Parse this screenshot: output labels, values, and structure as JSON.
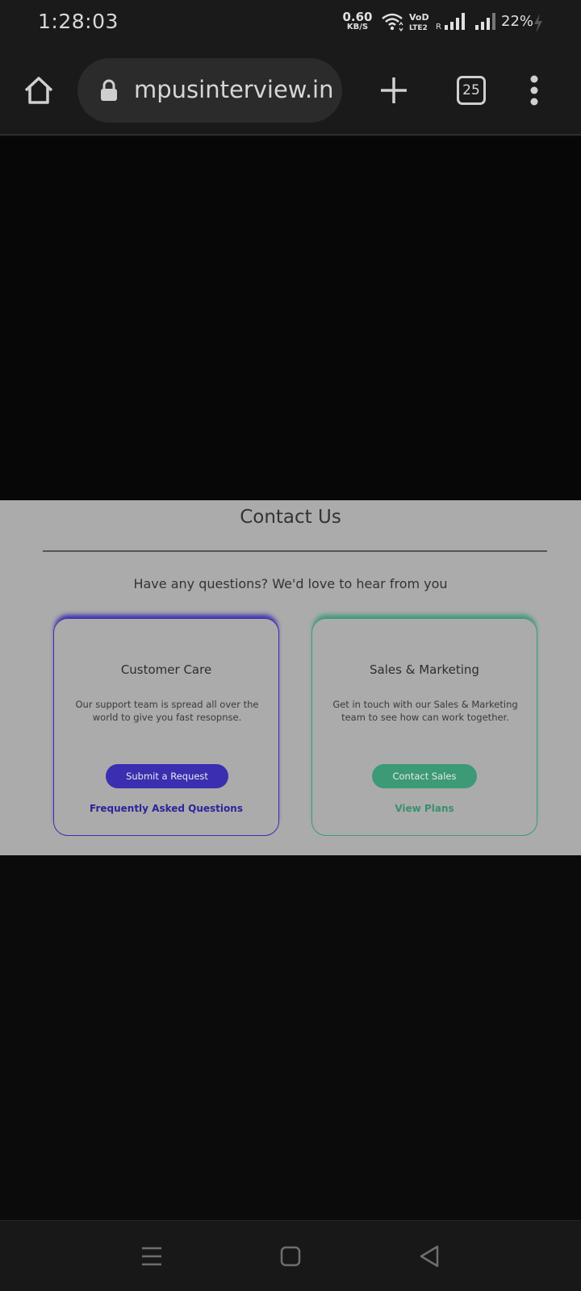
{
  "status_bar": {
    "time": "1:28:03",
    "speed_value": "0.60",
    "speed_unit": "KB/S",
    "battery": "22%",
    "icons": [
      "wifi-icon",
      "volte-icon",
      "signal-icon",
      "signal-icon",
      "charging-icon"
    ]
  },
  "browser": {
    "url": "mpusinterview.in",
    "tab_count": "25",
    "icons": [
      "home-icon",
      "lock-icon",
      "plus-icon",
      "more-vert-icon"
    ]
  },
  "contact": {
    "title": "Contact Us",
    "subtitle": "Have any questions? We'd love to hear from you",
    "care": {
      "title": "Customer Care",
      "description": "Our support team is spread all over the world to give you fast resopnse.",
      "button": "Submit a Request",
      "link": "Frequently Asked Questions",
      "accent": "#3a2fb0"
    },
    "sales": {
      "title": "Sales & Marketing",
      "description": "Get in touch with our Sales & Marketing team to see how can work together.",
      "button": "Contact Sales",
      "link": "View Plans",
      "accent": "#3c9a76"
    }
  },
  "nav": {
    "icons": [
      "recents-icon",
      "home-square-icon",
      "back-icon"
    ]
  }
}
